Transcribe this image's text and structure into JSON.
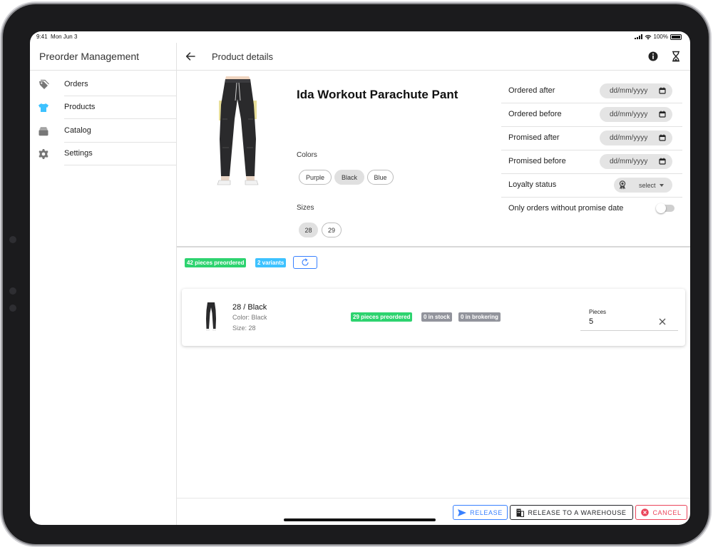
{
  "status_bar": {
    "time": "9:41",
    "date": "Mon Jun 3",
    "battery": "100%"
  },
  "sidebar": {
    "title": "Preorder Management",
    "items": [
      {
        "label": "Orders",
        "icon": "pricetags-icon",
        "active": false
      },
      {
        "label": "Products",
        "icon": "shirt-icon",
        "active": true
      },
      {
        "label": "Catalog",
        "icon": "albums-icon",
        "active": false
      },
      {
        "label": "Settings",
        "icon": "settings-icon",
        "active": false
      }
    ]
  },
  "header": {
    "title": "Product details"
  },
  "product": {
    "name": "Ida Workout Parachute Pant",
    "colors_label": "Colors",
    "colors": [
      "Purple",
      "Black",
      "Blue"
    ],
    "selected_color": "Black",
    "sizes_label": "Sizes",
    "sizes": [
      "28",
      "29"
    ],
    "selected_size": "28"
  },
  "filters": {
    "ordered_after": {
      "label": "Ordered after",
      "placeholder": "dd/mm/yyyy"
    },
    "ordered_before": {
      "label": "Ordered before",
      "placeholder": "dd/mm/yyyy"
    },
    "promised_after": {
      "label": "Promised after",
      "placeholder": "dd/mm/yyyy"
    },
    "promised_before": {
      "label": "Promised before",
      "placeholder": "dd/mm/yyyy"
    },
    "loyalty_status": {
      "label": "Loyalty status",
      "value": "select"
    },
    "no_promise_date": {
      "label": "Only orders without promise date",
      "enabled": false
    }
  },
  "summary": {
    "preordered": "42 pieces preordered",
    "variants": "2 variants"
  },
  "variant": {
    "title": "28 / Black",
    "color": "Color: Black",
    "size": "Size: 28",
    "badges": {
      "preordered": "29 pieces preordered",
      "stock": "0 in stock",
      "brokering": "0 in brokering"
    },
    "pieces_label": "Pieces",
    "pieces_value": "5"
  },
  "footer": {
    "release": "RELEASE",
    "release_warehouse": "RELEASE TO A WAREHOUSE",
    "cancel": "CANCEL"
  },
  "colors": {
    "accent": "#3880ff",
    "success": "#2dd36f",
    "info": "#3dc2ff",
    "medium": "#92949c",
    "danger": "#eb445a",
    "dark": "#222428"
  }
}
